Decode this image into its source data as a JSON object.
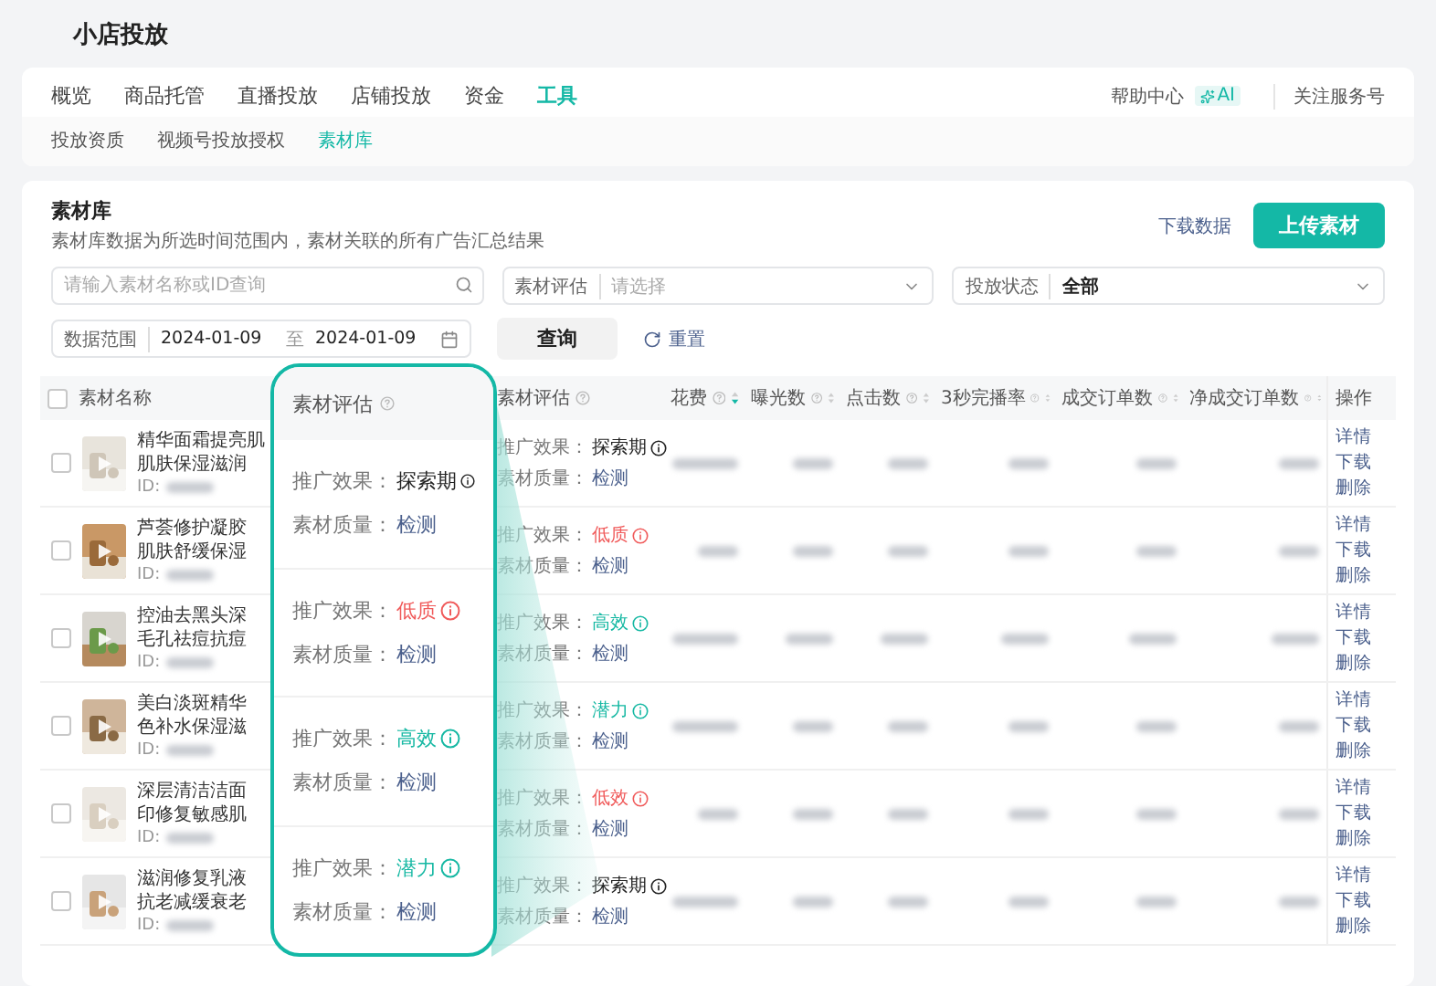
{
  "page_title": "小店投放",
  "nav": {
    "tabs": [
      {
        "label": "概览",
        "selected": false
      },
      {
        "label": "商品托管",
        "selected": false
      },
      {
        "label": "直播投放",
        "selected": false
      },
      {
        "label": "店铺投放",
        "selected": false
      },
      {
        "label": "资金",
        "selected": false
      },
      {
        "label": "工具",
        "selected": true
      }
    ],
    "help": "帮助中心",
    "help_badge": "AI",
    "follow": "关注服务号"
  },
  "sub_tabs": [
    {
      "label": "投放资质",
      "selected": false
    },
    {
      "label": "视频号投放授权",
      "selected": false
    },
    {
      "label": "素材库",
      "selected": true
    }
  ],
  "library": {
    "title": "素材库",
    "description": "素材库数据为所选时间范围内，素材关联的所有广告汇总结果",
    "download": "下载数据",
    "upload": "上传素材"
  },
  "filters": {
    "search_placeholder": "请输入素材名称或ID查询",
    "evaluation_label": "素材评估",
    "evaluation_placeholder": "请选择",
    "status_label": "投放状态",
    "status_value": "全部",
    "range_label": "数据范围",
    "start_date": "2024-01-09",
    "separator": "至",
    "end_date": "2024-01-09",
    "query": "查询",
    "reset": "重置"
  },
  "table": {
    "select_all": {
      "checked": false
    },
    "columns": [
      {
        "label": "素材名称",
        "kind": "select"
      },
      {
        "label": "素材评估",
        "kind": "help"
      },
      {
        "label": "花费",
        "kind": "sort",
        "sorted": true
      },
      {
        "label": "曝光数",
        "kind": "sort",
        "sorted": false
      },
      {
        "label": "点击数",
        "kind": "sort",
        "sorted": false
      },
      {
        "label": "3秒完播率",
        "kind": "sort",
        "sorted": false
      },
      {
        "label": "成交订单数",
        "kind": "sort",
        "sorted": false
      },
      {
        "label": "净成交订单数",
        "kind": "sort",
        "sorted": false
      },
      {
        "label": "操作",
        "kind": "plain"
      }
    ],
    "rows": [
      {
        "checked": false,
        "name_lines": [
          "精华面霜提亮肌",
          "肌肤保湿滋润"
        ],
        "id_label": "ID:",
        "effect_label": "推广效果：",
        "effect": "探索期",
        "color": "#222222",
        "quality_label": "素材质量：",
        "quality": "检测",
        "actions": [
          "详情",
          "下载",
          "删除"
        ]
      },
      {
        "checked": false,
        "name_lines": [
          "芦荟修护凝胶",
          "肌肤舒缓保湿"
        ],
        "id_label": "ID:",
        "effect_label": "推广效果：",
        "effect": "低质",
        "color": "#f05a5a",
        "quality_label": "素材质量：",
        "quality": "检测",
        "actions": [
          "详情",
          "下载",
          "删除"
        ]
      },
      {
        "checked": false,
        "name_lines": [
          "控油去黑头深",
          "毛孔祛痘抗痘"
        ],
        "id_label": "ID:",
        "effect_label": "推广效果：",
        "effect": "高效",
        "color": "#16b8a3",
        "quality_label": "素材质量：",
        "quality": "检测",
        "actions": [
          "详情",
          "下载",
          "删除"
        ]
      },
      {
        "checked": false,
        "name_lines": [
          "美白淡斑精华",
          "色补水保湿滋"
        ],
        "id_label": "ID:",
        "effect_label": "推广效果：",
        "effect": "潜力",
        "color": "#16b8a3",
        "quality_label": "素材质量：",
        "quality": "检测",
        "actions": [
          "详情",
          "下载",
          "删除"
        ]
      },
      {
        "checked": false,
        "name_lines": [
          "深层清洁洁面",
          "印修复敏感肌"
        ],
        "id_label": "ID:",
        "effect_label": "推广效果：",
        "effect": "低效",
        "color": "#f05a5a",
        "quality_label": "素材质量：",
        "quality": "检测",
        "actions": [
          "详情",
          "下载",
          "删除"
        ]
      },
      {
        "checked": false,
        "name_lines": [
          "滋润修复乳液",
          "抗老减缓衰老"
        ],
        "id_label": "ID:",
        "effect_label": "推广效果：",
        "effect": "探索期",
        "color": "#222222",
        "quality_label": "素材质量：",
        "quality": "检测",
        "actions": [
          "详情",
          "下载",
          "删除"
        ]
      }
    ]
  },
  "callout": {
    "title": "素材评估",
    "entries": [
      {
        "effect_label": "推广效果：",
        "effect": "探索期",
        "color": "#222222",
        "quality_label": "素材质量：",
        "quality": "检测"
      },
      {
        "effect_label": "推广效果：",
        "effect": "低质",
        "color": "#f05a5a",
        "quality_label": "素材质量：",
        "quality": "检测"
      },
      {
        "effect_label": "推广效果：",
        "effect": "高效",
        "color": "#16b8a3",
        "quality_label": "素材质量：",
        "quality": "检测"
      },
      {
        "effect_label": "推广效果：",
        "effect": "潜力",
        "color": "#16b8a3",
        "quality_label": "素材质量：",
        "quality": "检测"
      }
    ]
  }
}
